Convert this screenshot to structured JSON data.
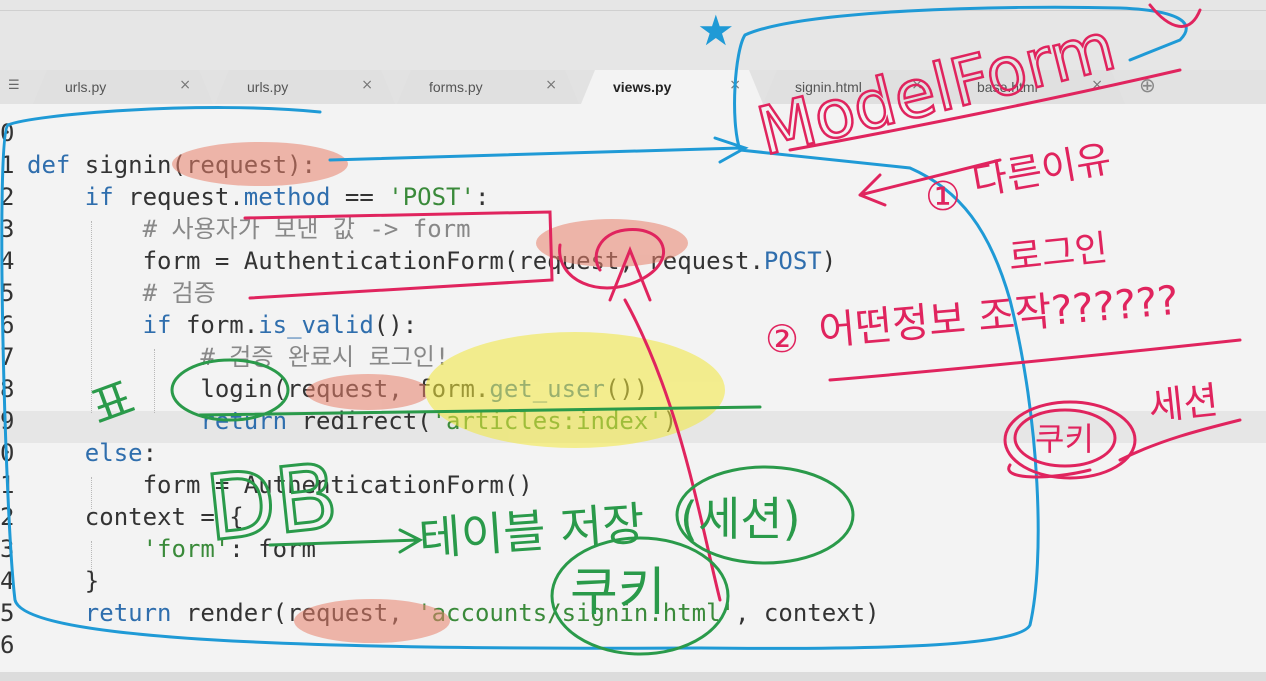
{
  "tabs": [
    {
      "label": "urls.py",
      "active": false
    },
    {
      "label": "urls.py",
      "active": false
    },
    {
      "label": "forms.py",
      "active": false
    },
    {
      "label": "views.py",
      "active": true
    },
    {
      "label": "signin.html",
      "active": false
    },
    {
      "label": "base.html",
      "active": false
    }
  ],
  "tab_close_glyph": "×",
  "line_numbers": [
    "0",
    "1",
    "2",
    "3",
    "4",
    "5",
    "6",
    "7",
    "8",
    "9",
    "0",
    "1",
    "2",
    "3",
    "4",
    "5",
    "6"
  ],
  "code": {
    "l1_def": "def",
    "l1_rest": " signin(request):",
    "l2_if": "if",
    "l2_a": " request.",
    "l2_method": "method",
    "l2_b": " == ",
    "l2_post": "'POST'",
    "l2_c": ":",
    "l3_comment": "# 사용자가 보낸 값 -> form",
    "l4_a": "form = AuthenticationForm(request, request.",
    "l4_post": "POST",
    "l4_b": ")",
    "l5_comment": "# 검증",
    "l6_if": "if",
    "l6_a": " form.",
    "l6_isvalid": "is_valid",
    "l6_b": "():",
    "l7_comment": "# 검증 완료시 로그인!",
    "l8_a": "login(request, form.",
    "l8_getuser": "get_user",
    "l8_b": "())",
    "l9_return": "return",
    "l9_a": " redirect(",
    "l9_str": "'articles:index'",
    "l9_b": ")",
    "l10_else": "else",
    "l10_a": ":",
    "l11": "form = AuthenticationForm()",
    "l12": "context = {",
    "l13_key": "'form'",
    "l13_rest": ": form",
    "l14": "}",
    "l15_return": "return",
    "l15_a": " render(request, ",
    "l15_str": "'accounts/signin.html'",
    "l15_b": ", context)"
  },
  "annotations": {
    "star": "★",
    "modelform": "ModelForm",
    "circle_1": "①",
    "diff_reason": "다른이유",
    "login_word": "로그인",
    "circle_2": "②",
    "question_text": "어떤정보 조작??????",
    "cookie_red": "쿠키",
    "session_red": "세션",
    "db": "DB",
    "table_save": "테이블 저장",
    "session_paren": "(세션)",
    "cookie_green": "쿠키",
    "green_mark": "표"
  },
  "colors": {
    "blue_ink": "#1f9ad6",
    "red_ink": "#e0245e",
    "green_ink": "#2a9a4a",
    "salmon_hl": "#e8806a",
    "yellow_hl": "#f2e83a"
  }
}
